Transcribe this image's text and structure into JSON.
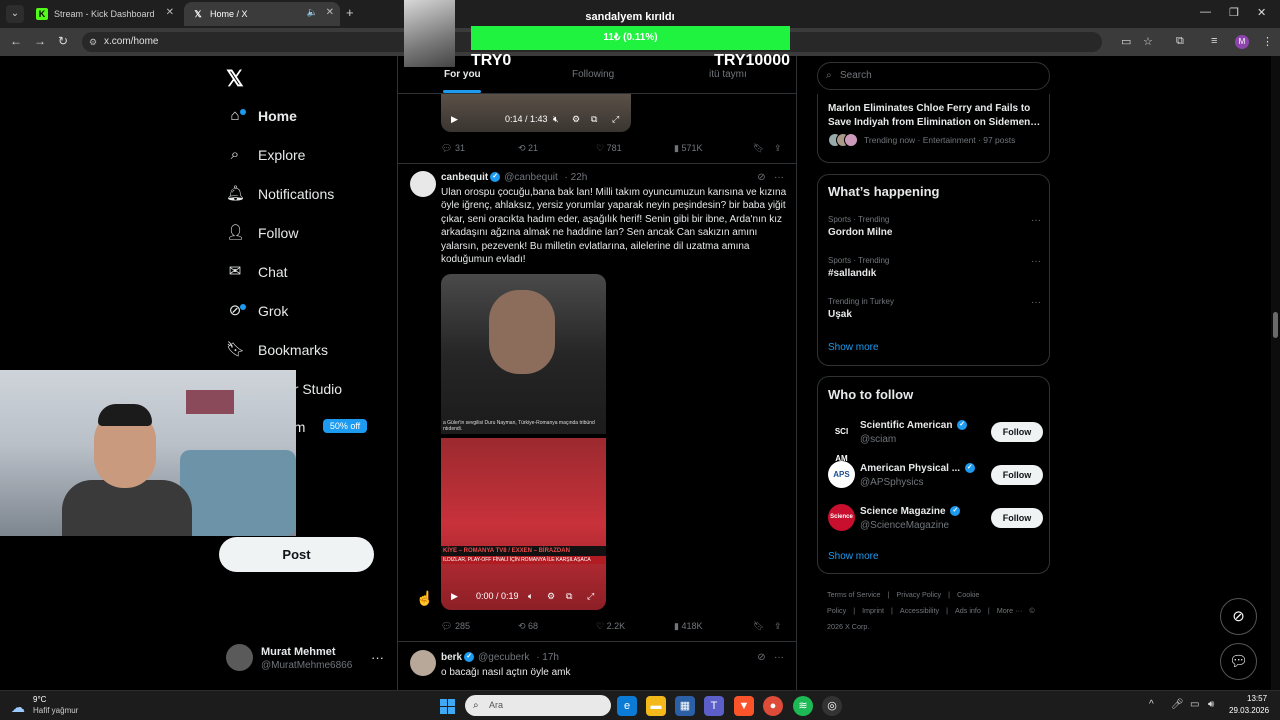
{
  "browser": {
    "tabs": [
      {
        "label": "Stream - Kick Dashboard",
        "favicon": "kick-icon"
      },
      {
        "label": "Home / X",
        "favicon": "x-icon"
      }
    ],
    "url": "x.com/home",
    "profile_initial": "M"
  },
  "overlay": {
    "title": "sandalyem kırıldı",
    "progress_text": "11₺ (0.11%)",
    "progress_fraction": 0.0011,
    "min_label": "TRY0",
    "max_label": "TRY10000"
  },
  "sidebar": {
    "items": [
      {
        "label": "Home",
        "icon": "home-icon"
      },
      {
        "label": "Explore",
        "icon": "search-icon"
      },
      {
        "label": "Notifications",
        "icon": "bell-icon"
      },
      {
        "label": "Follow",
        "icon": "add-user-icon"
      },
      {
        "label": "Chat",
        "icon": "mail-icon"
      },
      {
        "label": "Grok",
        "icon": "grok-icon"
      },
      {
        "label": "Bookmarks",
        "icon": "bookmark-icon"
      },
      {
        "label": "or Studio",
        "icon": "studio-icon"
      },
      {
        "label": "um",
        "icon": "premium-icon"
      }
    ],
    "premium_badge": "50% off",
    "post_button": "Post",
    "account": {
      "name": "Murat Mehmet",
      "handle": "@MuratMehme6866"
    }
  },
  "timeline": {
    "tabs": [
      "For you",
      "Following",
      "itü taymı"
    ],
    "first_video": {
      "time": "0:14 / 1:43"
    },
    "first_actions": {
      "replies": "31",
      "reposts": "21",
      "likes": "781",
      "views": "571K"
    },
    "tweet1": {
      "name": "canbequit",
      "handle": "@canbequit",
      "time": "· 22h",
      "text": "Ulan orospu çocuğu,bana bak lan! Milli takım oyuncumuzun karısına ve kızına öyle iğrenç, ahlaksız, yersiz yorumlar yaparak neyin peşindesin? bir baba yiğit çıkar, seni oracıkta hadım eder, aşağılık herif! Senin gibi bir ibne, Arda'nın kız arkadaşını ağzına almak ne haddine lan? Sen ancak Can sakızın amını yalarsın, pezevenk! Bu milletin evlatlarına, ailelerine dil uzatma amına koduğumun evladı!",
      "caption": "a Güler'in sevgilisi Duru Nayman, Türkiye-Romanya maçında tribünd ntıdendi.",
      "ticker": "KİYE – ROMANYA   TV8 / EXXEN – BİRAZDAN",
      "ticker2": "ILDIZLAR, PLAY-OFF FİNALİ İÇİN ROMANYA İLE KARŞILAŞACA",
      "video_time": "0:00 / 0:19",
      "actions": {
        "replies": "285",
        "reposts": "68",
        "likes": "2.2K",
        "views": "418K"
      }
    },
    "tweet2": {
      "name": "berk",
      "handle": "@gecuberk",
      "time": "· 17h",
      "text": "o bacağı nasıl açtın öyle amk"
    }
  },
  "right": {
    "search_placeholder": "Search",
    "live": {
      "title": "Marlon Eliminates Chloe Ferry and Fails to Save Indiyah from Elimination on Sidemen…",
      "meta": "Trending now · Entertainment · 97 posts"
    },
    "whats_happening": {
      "title": "What’s happening",
      "trends": [
        {
          "category": "Sports · Trending",
          "name": "Gordon Milne"
        },
        {
          "category": "Sports · Trending",
          "name": "#sallandık"
        },
        {
          "category": "Trending in Turkey",
          "name": "Uşak"
        }
      ],
      "show_more": "Show more"
    },
    "who_to_follow": {
      "title": "Who to follow",
      "accounts": [
        {
          "name": "Scientific American",
          "handle": "@sciam",
          "avatar_text": "SCI AM",
          "avatar_bg": "#000000",
          "avatar_fg": "#ffffff",
          "button": "Follow"
        },
        {
          "name": "American Physical ...",
          "handle": "@APSphysics",
          "avatar_text": "APS",
          "avatar_bg": "#ffffff",
          "avatar_fg": "#1d4f91",
          "button": "Follow"
        },
        {
          "name": "Science Magazine",
          "handle": "@ScienceMagazine",
          "avatar_text": "Science",
          "avatar_bg": "#c8102e",
          "avatar_fg": "#ffffff",
          "button": "Follow"
        }
      ],
      "show_more": "Show more"
    },
    "footer": [
      "Terms of Service",
      "|",
      "Privacy Policy",
      "|",
      "Cookie Policy",
      "|",
      "Imprint",
      "|",
      "Accessibility",
      "|",
      "Ads info",
      "|",
      "More ···",
      "© 2026 X Corp."
    ]
  },
  "taskbar": {
    "weather_temp": "9°C",
    "weather_desc": "Hafif yağmur",
    "search_placeholder": "Ara",
    "time": "13:57",
    "date": "29.03.2026"
  }
}
